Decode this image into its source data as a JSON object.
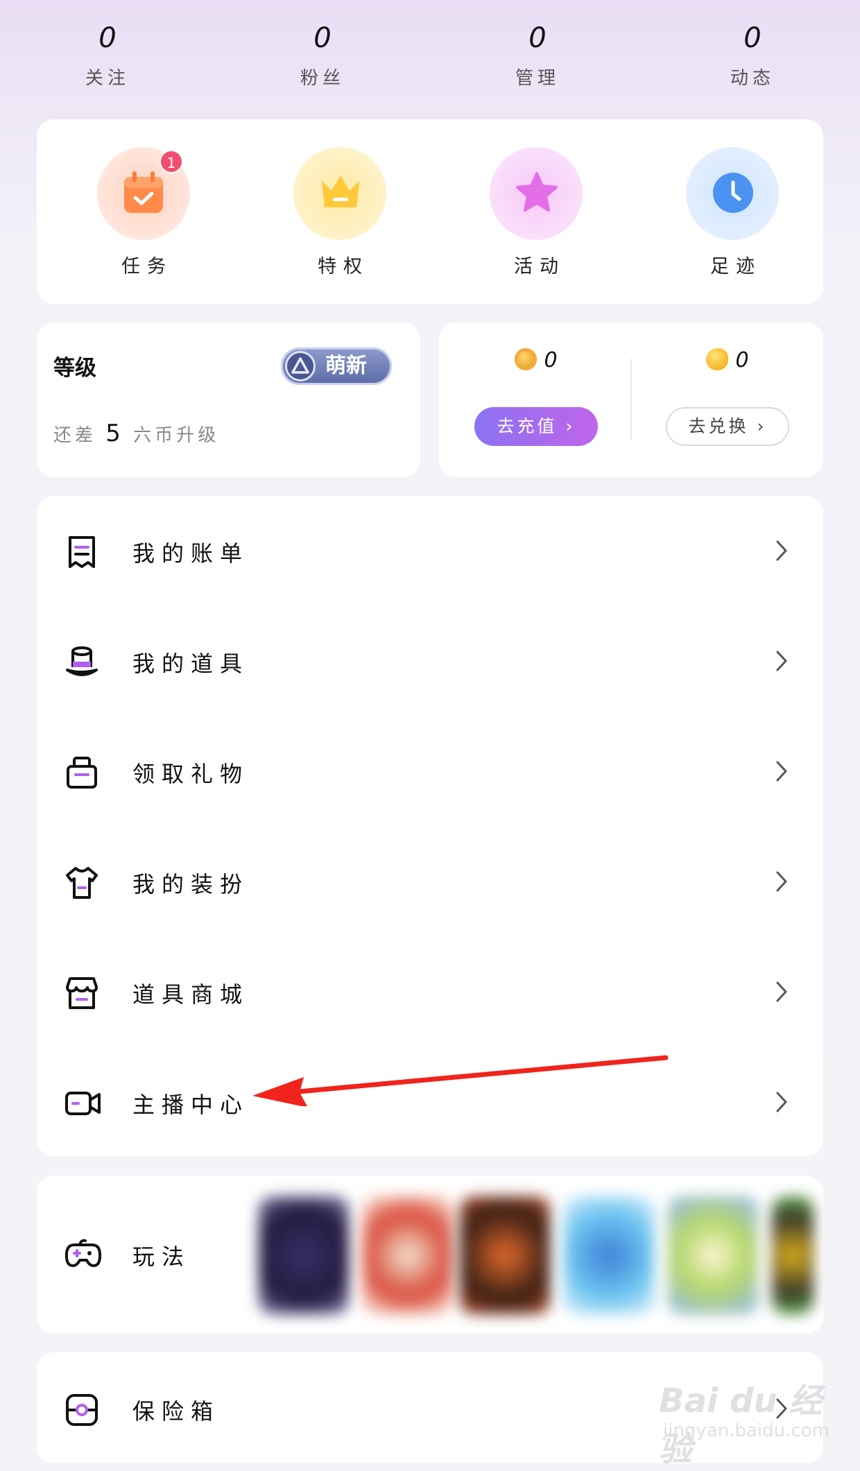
{
  "stats": [
    {
      "value": "0",
      "label": "关注"
    },
    {
      "value": "0",
      "label": "粉丝"
    },
    {
      "value": "0",
      "label": "管理"
    },
    {
      "value": "0",
      "label": "动态"
    }
  ],
  "quick": [
    {
      "label": "任务",
      "icon": "calendar-check-icon",
      "badge": "1"
    },
    {
      "label": "特权",
      "icon": "crown-icon"
    },
    {
      "label": "活动",
      "icon": "star-icon"
    },
    {
      "label": "足迹",
      "icon": "clock-icon"
    }
  ],
  "level": {
    "title": "等级",
    "badge": "萌新",
    "sub_prefix": "还差",
    "sub_amount": "5",
    "sub_suffix": "六币升级"
  },
  "wallet": {
    "coins": "0",
    "beans": "0",
    "recharge_label": "去充值 ›",
    "exchange_label": "去兑换 ›"
  },
  "menu": [
    {
      "label": "我的账单",
      "icon": "receipt-icon"
    },
    {
      "label": "我的道具",
      "icon": "top-hat-icon"
    },
    {
      "label": "领取礼物",
      "icon": "gift-icon"
    },
    {
      "label": "我的装扮",
      "icon": "shirt-icon"
    },
    {
      "label": "道具商城",
      "icon": "store-icon"
    },
    {
      "label": "主播中心",
      "icon": "video-camera-icon"
    }
  ],
  "play": {
    "label": "玩法",
    "icon": "gamepad-icon"
  },
  "safe": {
    "label": "保险箱",
    "icon": "safe-icon"
  },
  "watermark": {
    "line1": "Bai du 经验",
    "line2": "jingyan.baidu.com"
  },
  "colors": {
    "accent_purple": "#b15ff0",
    "recharge_start": "#8c72f2",
    "recharge_end": "#c065e9",
    "badge_red": "#f34d72",
    "annotation_red": "#f0241c"
  }
}
